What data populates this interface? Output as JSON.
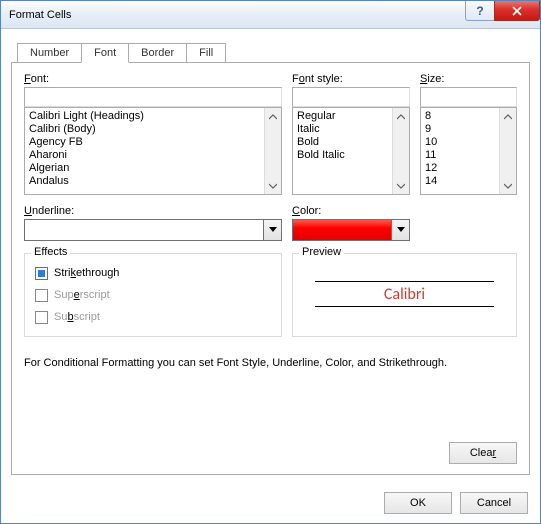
{
  "window": {
    "title": "Format Cells"
  },
  "tabs": [
    "Number",
    "Font",
    "Border",
    "Fill"
  ],
  "active_tab": 1,
  "font": {
    "label": "Font:",
    "value": "",
    "options": [
      "Calibri Light (Headings)",
      "Calibri (Body)",
      "Agency FB",
      "Aharoni",
      "Algerian",
      "Andalus"
    ]
  },
  "font_style": {
    "label": "Font style:",
    "value": "",
    "options": [
      "Regular",
      "Italic",
      "Bold",
      "Bold Italic"
    ]
  },
  "size": {
    "label": "Size:",
    "value": "",
    "options": [
      "8",
      "9",
      "10",
      "11",
      "12",
      "14"
    ]
  },
  "underline": {
    "label": "Underline:",
    "value": ""
  },
  "color": {
    "label": "Color:",
    "value": "#ff0000"
  },
  "effects": {
    "label": "Effects",
    "strikethrough": {
      "label": "Strikethrough",
      "checked": true
    },
    "superscript": {
      "label": "Superscript",
      "checked": false,
      "disabled": true
    },
    "subscript": {
      "label": "Subscript",
      "checked": false,
      "disabled": true
    }
  },
  "preview": {
    "label": "Preview",
    "text": "Calibri"
  },
  "note": "For Conditional Formatting you can set Font Style, Underline, Color, and Strikethrough.",
  "buttons": {
    "clear": "Clear",
    "ok": "OK",
    "cancel": "Cancel"
  }
}
